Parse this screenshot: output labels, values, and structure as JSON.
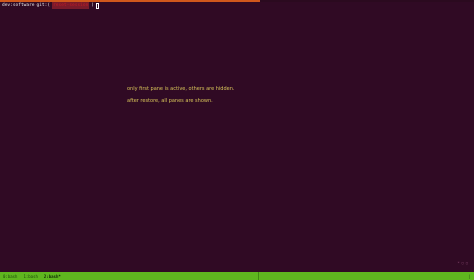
{
  "terminal": {
    "prompt": {
      "path": "dev:software",
      "git": "git:(",
      "branch": "reset-session",
      "branch_close": ")"
    },
    "messages": [
      "only first pane is active, others are hidden.",
      "after restore, all panes are shown."
    ],
    "pane_indicator": "* ▢ ▢"
  },
  "status_bar": {
    "windows": [
      {
        "label": "0:bash",
        "active": false
      },
      {
        "label": "1:bash",
        "active": false
      },
      {
        "label": "2:bash*",
        "active": true
      }
    ],
    "right": "|"
  },
  "colors": {
    "background": "#300a24",
    "message": "#d8c55a",
    "status_bar": "#5fb61f",
    "active_border": "#d0581c",
    "branch": "#c01c28"
  }
}
